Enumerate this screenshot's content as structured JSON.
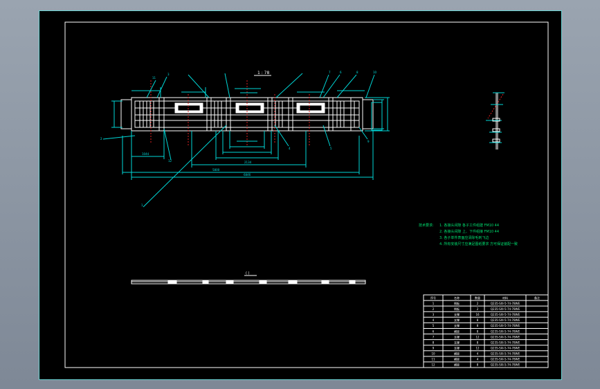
{
  "drawing": {
    "scale_label": "1 : 78",
    "section_label": "(   )",
    "dims": {
      "overall": "6846",
      "inner_span": "5800",
      "left_seg": "1044",
      "center": "2134"
    },
    "balloons": [
      "1",
      "2",
      "3",
      "4",
      "5",
      "6",
      "7",
      "8",
      "9",
      "10",
      "11",
      "12"
    ]
  },
  "notes": {
    "heading": "技术要求:",
    "items": [
      "1.  各接头间隙 各子工件组建 FM10 44",
      "2.  各接头间隙 上、下件组接 FM10 44",
      "3.  各子单件表面应清除毛刺飞边",
      "4.  所有安装尺寸应满足图纸要求 方可保证装配一致"
    ]
  },
  "bom": {
    "headers": [
      "序号",
      "名称",
      "数量",
      "材料",
      "备注"
    ],
    "rows": [
      [
        "1",
        "侧板",
        "2",
        "Q235-SXI-5-74-78WE",
        ""
      ],
      [
        "2",
        "侧板",
        "2",
        "Q235-SXI-5-74-78WE",
        ""
      ],
      [
        "3",
        "支撑",
        "16",
        "Q235-SXI-5-74-78WE",
        ""
      ],
      [
        "4",
        "支撑",
        "8",
        "Q235-SXI-5-74-78WE",
        ""
      ],
      [
        "5",
        "支撑",
        "8",
        "Q235-SXI-5-74-78WE",
        ""
      ],
      [
        "6",
        "横梁",
        "8",
        "Q235-SXI-5-74-78WE",
        ""
      ],
      [
        "7",
        "支撑",
        "12",
        "Q235-SXI-5-74-78WE",
        ""
      ],
      [
        "8",
        "支撑",
        "8",
        "Q235-SXI-5-74-78WE",
        ""
      ],
      [
        "9",
        "支撑",
        "12",
        "Q235-SXI-5-74-78WE",
        ""
      ],
      [
        "10",
        "横梁",
        "4",
        "Q235-SXI-5-74-78WE",
        ""
      ],
      [
        "11",
        "横梁",
        "4",
        "Q235-SXI-5-74-78WE",
        ""
      ],
      [
        "12",
        "横梁",
        "8",
        "Q235-SXI-5-74-78WE",
        ""
      ]
    ]
  }
}
